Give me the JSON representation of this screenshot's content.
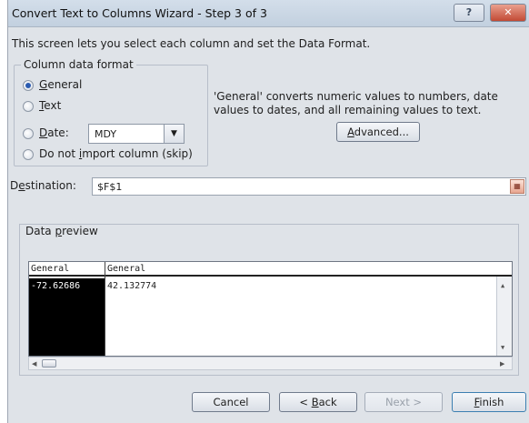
{
  "window": {
    "title": "Convert Text to Columns Wizard - Step 3 of 3",
    "help_label": "?",
    "close_label": "✕"
  },
  "intro_text": "This screen lets you select each column and set the Data Format.",
  "column_format": {
    "legend": "Column data format",
    "selected": "General",
    "options": {
      "general": {
        "accel": "G",
        "rest": "eneral"
      },
      "text": {
        "accel": "T",
        "rest": "ext"
      },
      "date": {
        "accel": "D",
        "rest": "ate:"
      },
      "skip": {
        "pre": "Do not ",
        "accel": "i",
        "rest": "mport column (skip)"
      }
    },
    "date_value": "MDY"
  },
  "description": "'General' converts numeric values to numbers, date values to dates, and all remaining values to text.",
  "advanced_button": {
    "accel": "A",
    "rest": "dvanced..."
  },
  "destination": {
    "pre": "D",
    "accel": "e",
    "rest": "stination:",
    "value": "$F$1"
  },
  "preview": {
    "legend_pre": "Data ",
    "legend_accel": "p",
    "legend_rest": "review",
    "headers": [
      "General",
      "General"
    ],
    "rows": [
      [
        "-72.62686",
        "42.132774"
      ]
    ]
  },
  "footer": {
    "cancel": "Cancel",
    "back_pre": "< ",
    "back_accel": "B",
    "back_rest": "ack",
    "next": "Next >",
    "finish_accel": "F",
    "finish_rest": "inish"
  }
}
